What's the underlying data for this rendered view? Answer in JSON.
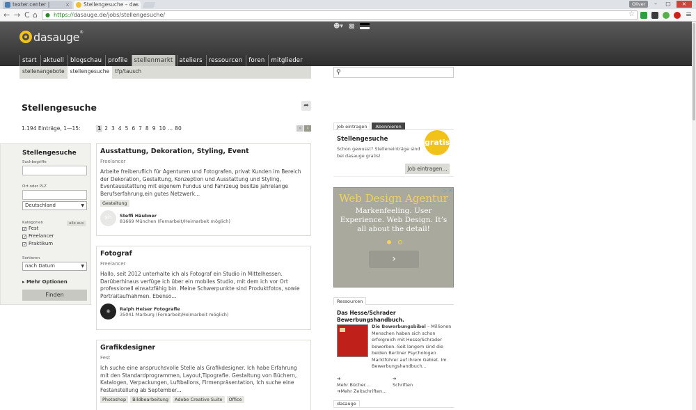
{
  "browser": {
    "tabs": [
      {
        "title": "texter.center |",
        "close": "×"
      },
      {
        "title": "Stellengesuche – das",
        "close": "×"
      }
    ],
    "user": "Oliver",
    "window": {
      "minimize": "–",
      "maximize": "□",
      "close": "×"
    },
    "url_scheme": "https://",
    "url_rest": "dasauge.de/jobs/stellengesuche/",
    "nav": {
      "back": "←",
      "forward": "→",
      "reload": "C",
      "home": "⌂"
    },
    "star": "☆",
    "menu": "≡"
  },
  "site": {
    "logo": "dasauge",
    "logo_mark": "®",
    "nav": [
      "start",
      "aktuell",
      "blogschau",
      "profile",
      "stellenmarkt",
      "ateliers",
      "ressourcen",
      "foren",
      "mitglieder"
    ],
    "active_nav": "stellenmarkt",
    "subnav": [
      "stellenangebote",
      "stellengesuche",
      "tfp/tausch"
    ],
    "active_subnav": "stellengesuche"
  },
  "main": {
    "title": "Stellengesuche",
    "count": "1.194 Einträge, 1—15:",
    "pages": [
      "1",
      "2",
      "3",
      "4",
      "5",
      "6",
      "7",
      "8",
      "9",
      "10",
      "...",
      "80"
    ],
    "current_page": "1",
    "prev": "‹",
    "next": "›"
  },
  "filter": {
    "title": "Stellengesuche",
    "search_label": "Suchbegriffe",
    "zip_label": "Ort oder PLZ",
    "country": "Deutschland",
    "categories_label": "Kategorien",
    "all_off": "alle aus",
    "categories": [
      "Fest",
      "Freelancer",
      "Praktikum"
    ],
    "sort_label": "Sortieren",
    "sort_value": "nach Datum",
    "more": "Mehr Optionen",
    "submit": "Finden"
  },
  "listings": [
    {
      "title": "Ausstattung, Dekoration, Styling, Event",
      "type": "Freelancer",
      "desc": "Arbeite freiberuflich für Agenturen und Fotografen, privat Kunden im Bereich der Dekoration, Gestaltung, Konzeption und Ausstattung und Styling, Eventausstattung mit eigenem Fundus und Fahrzeug besitze jahrelange Berufserfahrung,ein gutes Netzwerk...",
      "tags": [
        "Gestaltung"
      ],
      "avatar": "sh",
      "author": "Steffi Häubner",
      "location": "81669 München (Fernarbeit/Heimarbeit möglich)"
    },
    {
      "title": "Fotograf",
      "type": "Freelancer",
      "desc": "Hallo, seit 2012 unterhalte ich als Fotograf ein Studio in Mittelhessen. Darüberhinaus verfüge ich über ein mobiles Studio, mit dem ich vor Ort professionell einsatzfähig bin. Meine Schwerpunkte sind Produktfotos, sowie Portraitaufnahmen. Ebenso...",
      "tags": [],
      "avatar": "",
      "author": "Ralph Heiser Fotografie",
      "location": "35041 Marburg (Fernarbeit/Heimarbeit möglich)"
    },
    {
      "title": "Grafikdesigner",
      "type": "Fest",
      "desc": "Ich suche eine anspruchsvolle Stelle als Grafikdesigner. Ich habe Erfahrung mit den Standardprogrammen, Layout,Tipografie. Gestaltung von Büchern, Katalogen, Verpackungen, Luftballons, Firmenpräsentation, Ich suche eine Festanstellung ab September...",
      "tags": [
        "Photoshop",
        "Bildbearbeitung",
        "Adobe Creative Suite",
        "Office"
      ],
      "avatar": "",
      "author": "",
      "location": ""
    }
  ],
  "sidebar": {
    "tabs": [
      "Job eintragen",
      "Abonnieren"
    ],
    "job_title": "Stellengesuche",
    "job_text": "Schon gewusst? Stelleneinträge sind bei dasauge gratis!",
    "gratis": "gratis",
    "job_button": "Job eintragen...",
    "ad": {
      "headline": "Web Design Agentur",
      "body": "Markenfeeling. User Experience. Web Design. It’s all about the detail!",
      "next": "›",
      "badge": "▷ ✕"
    },
    "res_tab": "Ressourcen",
    "res_title": "Das Hesse/Schrader Bewerbungshandbuch.",
    "res_text_bold": "Die Bewerbungsbibel",
    "res_text": " – Millionen Menschen haben sich schon erfolgreich mit Hesse/Schrader beworben. Seit langem sind die beiden Berliner Psychologen Marktführer auf ihrem Gebiet. Im Bewerbungshandbuch...",
    "links": [
      "Mehr Bücher...",
      "Schriften",
      "Mehr Zeitschriften..."
    ],
    "bottom_tab": "dasauge"
  }
}
